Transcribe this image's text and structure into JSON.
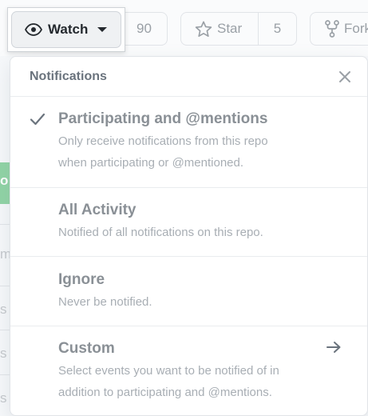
{
  "toolbar": {
    "watch_label": "Watch",
    "watch_count": "90",
    "star_label": "Star",
    "star_count": "5",
    "fork_label": "Fork"
  },
  "panel": {
    "title": "Notifications",
    "items": [
      {
        "title": "Participating and @mentions",
        "description_line1": "Only receive notifications from this repo",
        "description_line2": "when participating or @mentioned.",
        "selected": true
      },
      {
        "title": "All Activity",
        "description_line1": "Notified of all notifications on this repo."
      },
      {
        "title": "Ignore",
        "description_line1": "Never be notified."
      },
      {
        "title": "Custom",
        "description_line1": "Select events you want to be notified of in",
        "description_line2": "addition to participating and @mentions.",
        "has_arrow": true
      }
    ]
  },
  "background_hints": {
    "letters": [
      "o",
      "m",
      "s",
      "s",
      "s"
    ]
  },
  "icons": {
    "watch": "eye-icon",
    "watch_caret": "caret-down-icon",
    "star": "star-icon",
    "fork": "fork-icon",
    "close": "close-icon",
    "check": "check-icon",
    "custom_arrow": "arrow-right-icon"
  }
}
